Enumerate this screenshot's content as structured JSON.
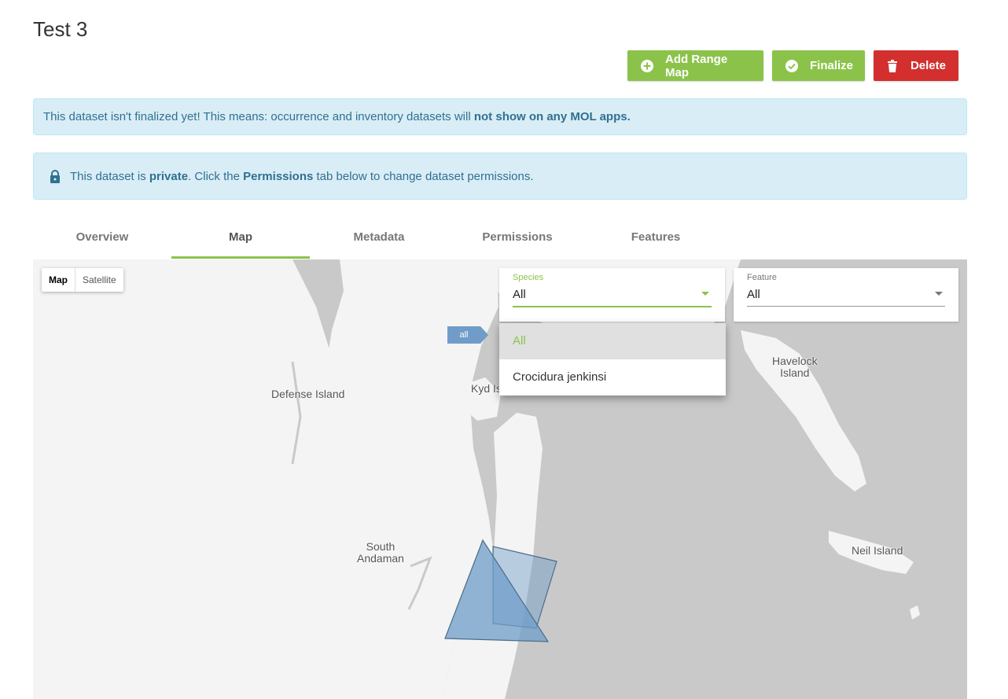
{
  "page": {
    "title": "Test 3"
  },
  "actions": {
    "add_range_map": "Add Range Map",
    "finalize": "Finalize",
    "delete": "Delete"
  },
  "alerts": {
    "finalize_notice": {
      "text": "This dataset isn't finalized yet! This means: occurrence and inventory datasets will ",
      "bold": "not show on any MOL apps."
    },
    "private_notice": {
      "prefix": "This dataset is ",
      "bold1": "private",
      "middle": ". Click the ",
      "bold2": "Permissions",
      "suffix": " tab below to change dataset permissions."
    }
  },
  "tabs": [
    {
      "label": "Overview",
      "active": false
    },
    {
      "label": "Map",
      "active": true
    },
    {
      "label": "Metadata",
      "active": false
    },
    {
      "label": "Permissions",
      "active": false
    },
    {
      "label": "Features",
      "active": false
    }
  ],
  "map": {
    "type_toggle": {
      "map": "Map",
      "satellite": "Satellite",
      "selected": "Map"
    },
    "species_select": {
      "label": "Species",
      "value": "All",
      "open": true
    },
    "feature_select": {
      "label": "Feature",
      "value": "All"
    },
    "species_options": [
      "All",
      "Crocidura jenkinsi"
    ],
    "marker_label": "all",
    "place_labels": {
      "defense": "Defense Island",
      "kyd": "Kyd Is",
      "havelock_1": "Havelock",
      "havelock_2": "Island",
      "south_1": "South",
      "south_2": "Andaman",
      "neil": "Neil Island"
    }
  },
  "colors": {
    "accent_green": "#8bc34a",
    "danger_red": "#d32f2f",
    "info_bg": "#d9edf7",
    "info_text": "#31708f",
    "polygon_fill": "#6f9cc8"
  },
  "icons": {
    "add": "plus-circle-icon",
    "finalize": "check-circle-icon",
    "delete": "trash-icon",
    "lock": "lock-icon"
  }
}
